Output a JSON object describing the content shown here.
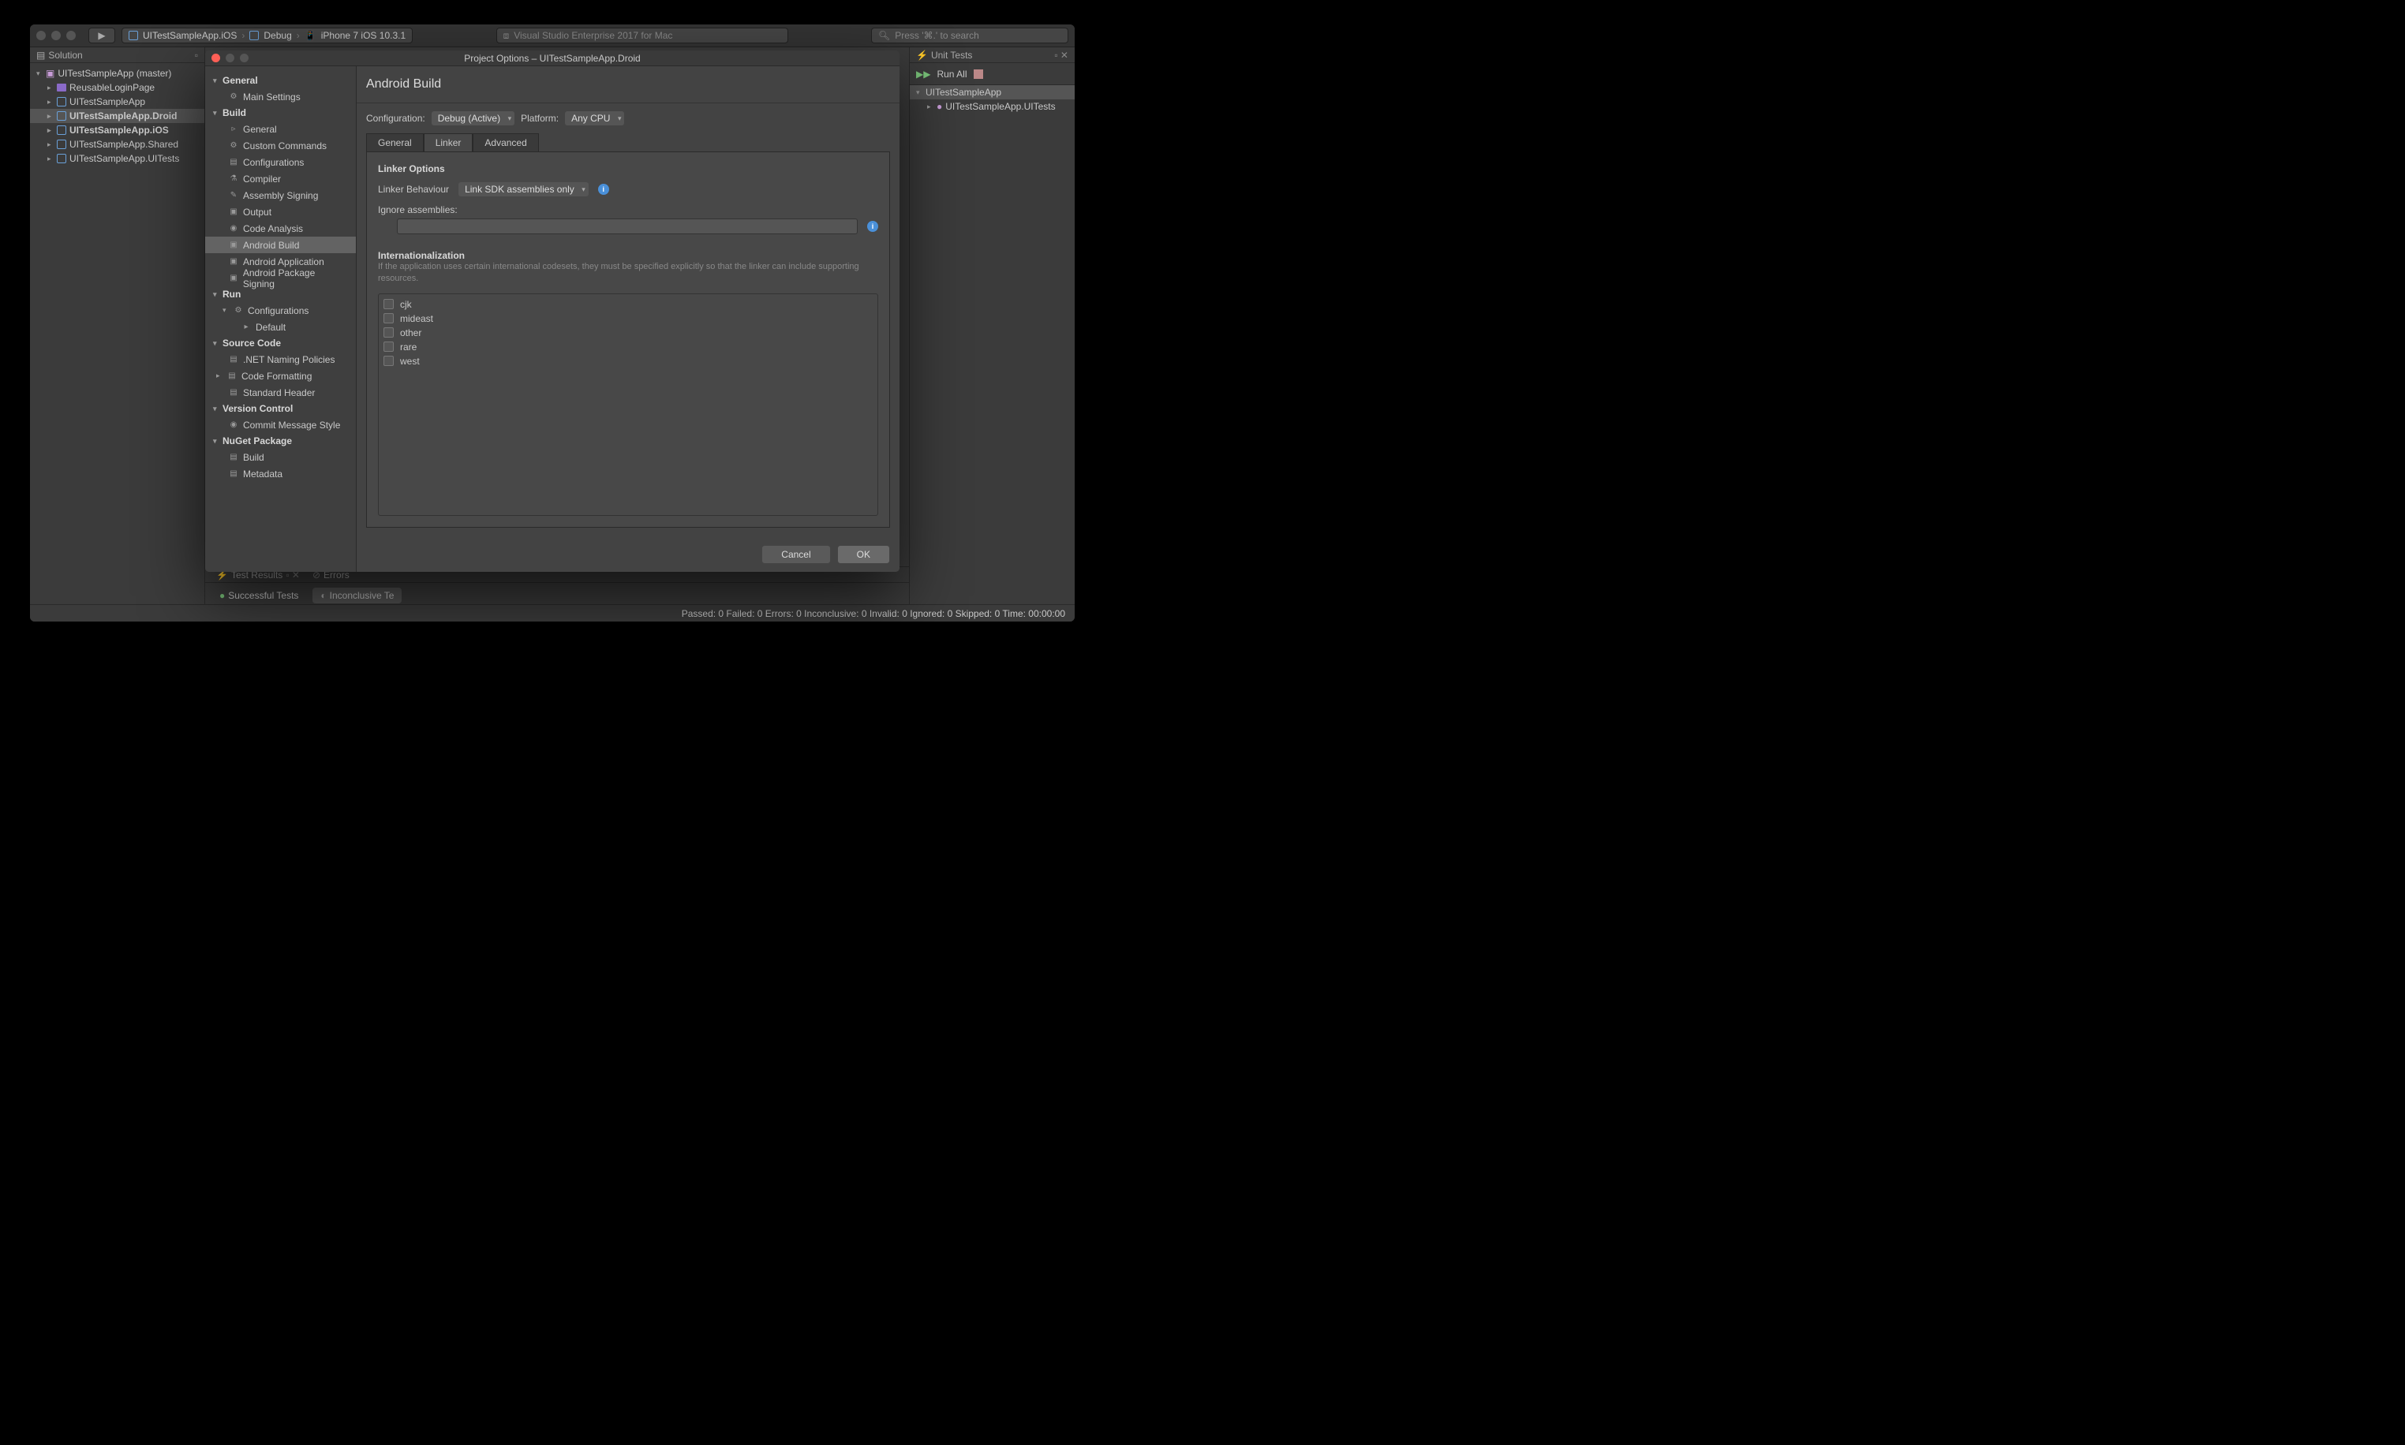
{
  "titlebar": {
    "breadcrumb": {
      "project": "UITestSampleApp.iOS",
      "config": "Debug",
      "device": "iPhone 7 iOS 10.3.1"
    },
    "center": "Visual Studio Enterprise 2017 for Mac",
    "search_placeholder": "Press '⌘.' to search"
  },
  "solution_pad": {
    "title": "Solution",
    "root": "UITestSampleApp (master)",
    "items": [
      {
        "label": "ReusableLoginPage",
        "icon": "folder"
      },
      {
        "label": "UITestSampleApp",
        "icon": "proj",
        "bold": false
      },
      {
        "label": "UITestSampleApp.Droid",
        "icon": "proj",
        "bold": true,
        "selected": true
      },
      {
        "label": "UITestSampleApp.iOS",
        "icon": "proj",
        "bold": true
      },
      {
        "label": "UITestSampleApp.Shared",
        "icon": "proj",
        "bold": false
      },
      {
        "label": "UITestSampleApp.UITests",
        "icon": "proj",
        "bold": false
      }
    ]
  },
  "unit_tests": {
    "title": "Unit Tests",
    "run_all": "Run All",
    "root": "UITestSampleApp",
    "child": "UITestSampleApp.UITests"
  },
  "bottom": {
    "test_results": "Test Results",
    "errors": "Errors",
    "successful": "Successful Tests",
    "inconclusive": "Inconclusive Te"
  },
  "statusbar": "Passed: 0   Failed: 0   Errors: 0   Inconclusive: 0   Invalid: 0   Ignored: 0   Skipped: 0   Time: 00:00:00",
  "modal": {
    "title": "Project Options – UITestSampleApp.Droid",
    "header": "Android Build",
    "config_label": "Configuration:",
    "config_value": "Debug (Active)",
    "platform_label": "Platform:",
    "platform_value": "Any CPU",
    "tabs": {
      "general": "General",
      "linker": "Linker",
      "advanced": "Advanced"
    },
    "linker_options_title": "Linker Options",
    "linker_behaviour_label": "Linker Behaviour",
    "linker_behaviour_value": "Link SDK assemblies only",
    "ignore_label": "Ignore assemblies:",
    "i18n_title": "Internationalization",
    "i18n_desc": "If the application uses certain international codesets, they must be specified explicitly so that the linker can include supporting resources.",
    "i18n_items": [
      "cjk",
      "mideast",
      "other",
      "rare",
      "west"
    ],
    "cancel": "Cancel",
    "ok": "OK",
    "sidebar": [
      {
        "type": "cat",
        "label": "General"
      },
      {
        "type": "item",
        "label": "Main Settings",
        "icon": "⚙"
      },
      {
        "type": "cat",
        "label": "Build"
      },
      {
        "type": "item",
        "label": "General",
        "icon": "▹"
      },
      {
        "type": "item",
        "label": "Custom Commands",
        "icon": "⚙"
      },
      {
        "type": "item",
        "label": "Configurations",
        "icon": "▤"
      },
      {
        "type": "item",
        "label": "Compiler",
        "icon": "⚗"
      },
      {
        "type": "item",
        "label": "Assembly Signing",
        "icon": "✎"
      },
      {
        "type": "item",
        "label": "Output",
        "icon": "▣"
      },
      {
        "type": "item",
        "label": "Code Analysis",
        "icon": "◉"
      },
      {
        "type": "item",
        "label": "Android Build",
        "icon": "▣",
        "selected": true
      },
      {
        "type": "item",
        "label": "Android Application",
        "icon": "▣"
      },
      {
        "type": "item",
        "label": "Android Package Signing",
        "icon": "▣"
      },
      {
        "type": "cat",
        "label": "Run"
      },
      {
        "type": "subcat",
        "label": "Configurations",
        "icon": "⚙"
      },
      {
        "type": "subitem",
        "label": "Default",
        "icon": "▸"
      },
      {
        "type": "cat",
        "label": "Source Code"
      },
      {
        "type": "item",
        "label": ".NET Naming Policies",
        "icon": "▤"
      },
      {
        "type": "item",
        "label": "Code Formatting",
        "icon": "▤",
        "caret": true
      },
      {
        "type": "item",
        "label": "Standard Header",
        "icon": "▤"
      },
      {
        "type": "cat",
        "label": "Version Control"
      },
      {
        "type": "item",
        "label": "Commit Message Style",
        "icon": "◉"
      },
      {
        "type": "cat",
        "label": "NuGet Package"
      },
      {
        "type": "item",
        "label": "Build",
        "icon": "▤"
      },
      {
        "type": "item",
        "label": "Metadata",
        "icon": "▤"
      }
    ]
  }
}
